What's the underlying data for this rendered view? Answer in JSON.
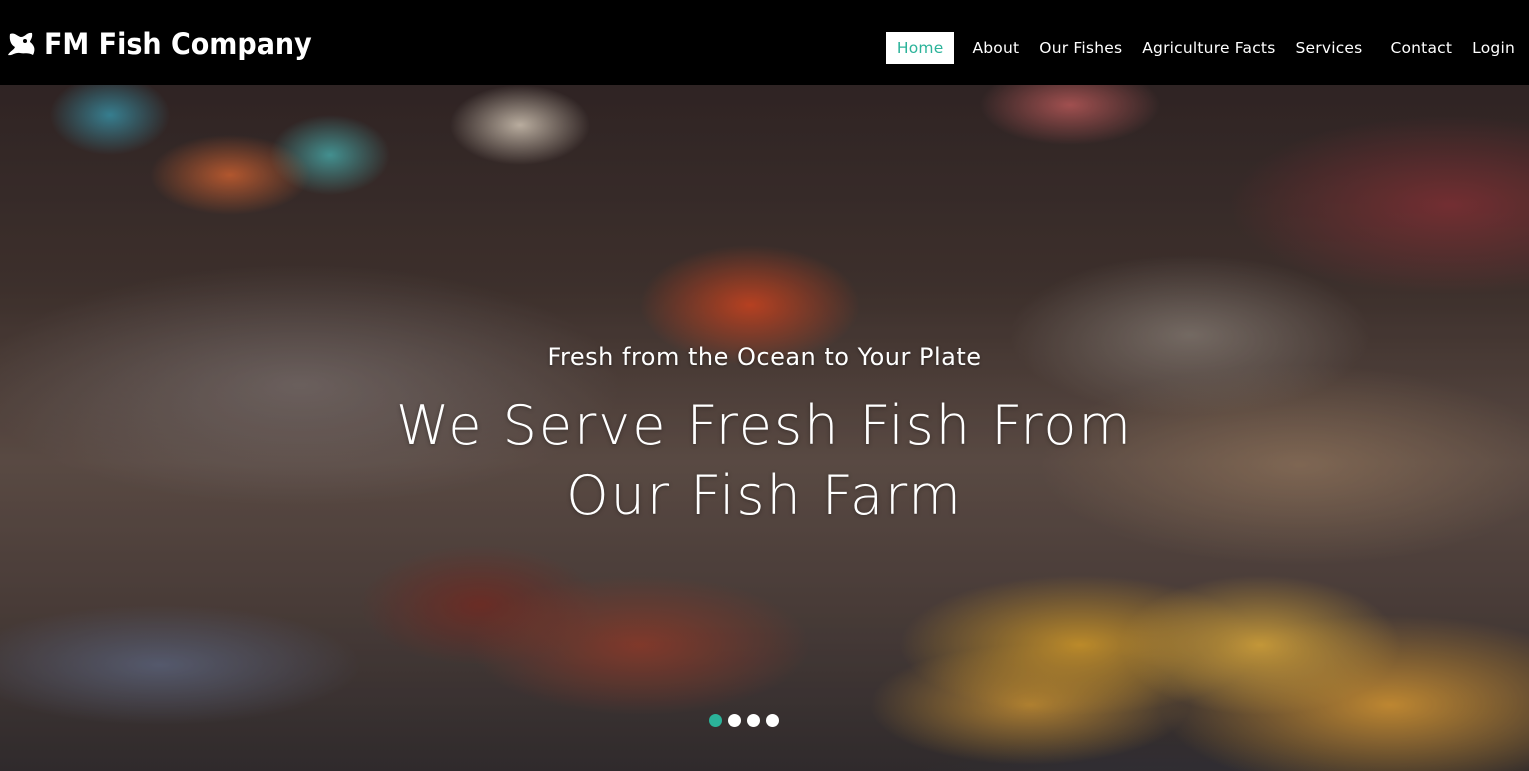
{
  "brand": {
    "name": "FM Fish Company",
    "icon": "fish-logo-icon"
  },
  "nav": {
    "items": [
      {
        "label": "Home",
        "active": true
      },
      {
        "label": "About"
      },
      {
        "label": "Our Fishes"
      },
      {
        "label": "Agriculture Facts"
      },
      {
        "label": "Services"
      },
      {
        "label": "Contact"
      },
      {
        "label": "Login"
      }
    ]
  },
  "hero": {
    "subtitle": "Fresh from the Ocean to Your Plate",
    "title_line1": "We Serve Fresh Fish From",
    "title_line2": "Our Fish Farm",
    "slides_total": 4,
    "active_slide": 1
  },
  "colors": {
    "accent": "#2bb39a",
    "navbar_bg": "#000000"
  }
}
